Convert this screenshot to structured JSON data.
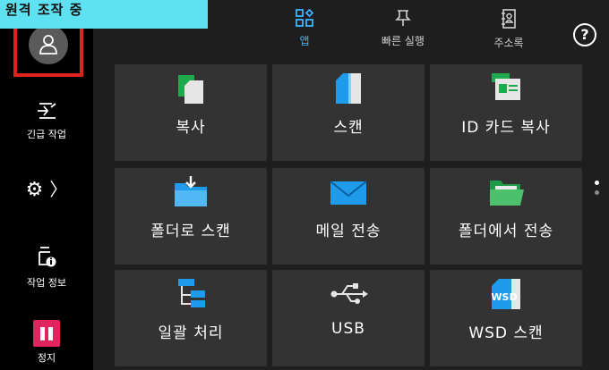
{
  "status_banner": {
    "text": "원격 조작 중"
  },
  "left_panel": {
    "user_button": {
      "icon": "user-icon"
    },
    "emergency_job": {
      "label": "긴급 작업",
      "icon": "emergency-job-icon"
    },
    "settings": {
      "icon": "gear-icon",
      "arrow": "〉"
    },
    "job_info": {
      "label": "작업 정보",
      "icon": "job-info-icon"
    },
    "stop": {
      "label": "정지",
      "icon": "pause-icon",
      "color": "#e0245e"
    }
  },
  "top_nav": {
    "tabs": [
      {
        "label": "앱",
        "icon": "apps-grid-icon",
        "active": true
      },
      {
        "label": "빠른 실행",
        "icon": "pin-icon",
        "active": false
      },
      {
        "label": "주소록",
        "icon": "address-book-icon",
        "active": false
      }
    ],
    "help": {
      "icon": "help-icon",
      "symbol": "?"
    },
    "active_color": "#3fb3ff"
  },
  "apps": [
    {
      "label": "복사",
      "icon": "copy-icon"
    },
    {
      "label": "스캔",
      "icon": "scan-icon"
    },
    {
      "label": "ID 카드 복사",
      "icon": "id-card-copy-icon"
    },
    {
      "label": "폴더로 스캔",
      "icon": "scan-to-folder-icon"
    },
    {
      "label": "메일 전송",
      "icon": "email-icon"
    },
    {
      "label": "폴더에서 전송",
      "icon": "send-from-folder-icon"
    },
    {
      "label": "일괄 처리",
      "icon": "batch-process-icon"
    },
    {
      "label": "USB",
      "icon": "usb-icon"
    },
    {
      "label": "WSD 스캔",
      "icon": "wsd-scan-icon",
      "badge": "WSD"
    }
  ],
  "pagination": {
    "pages": 2,
    "current": 1
  }
}
